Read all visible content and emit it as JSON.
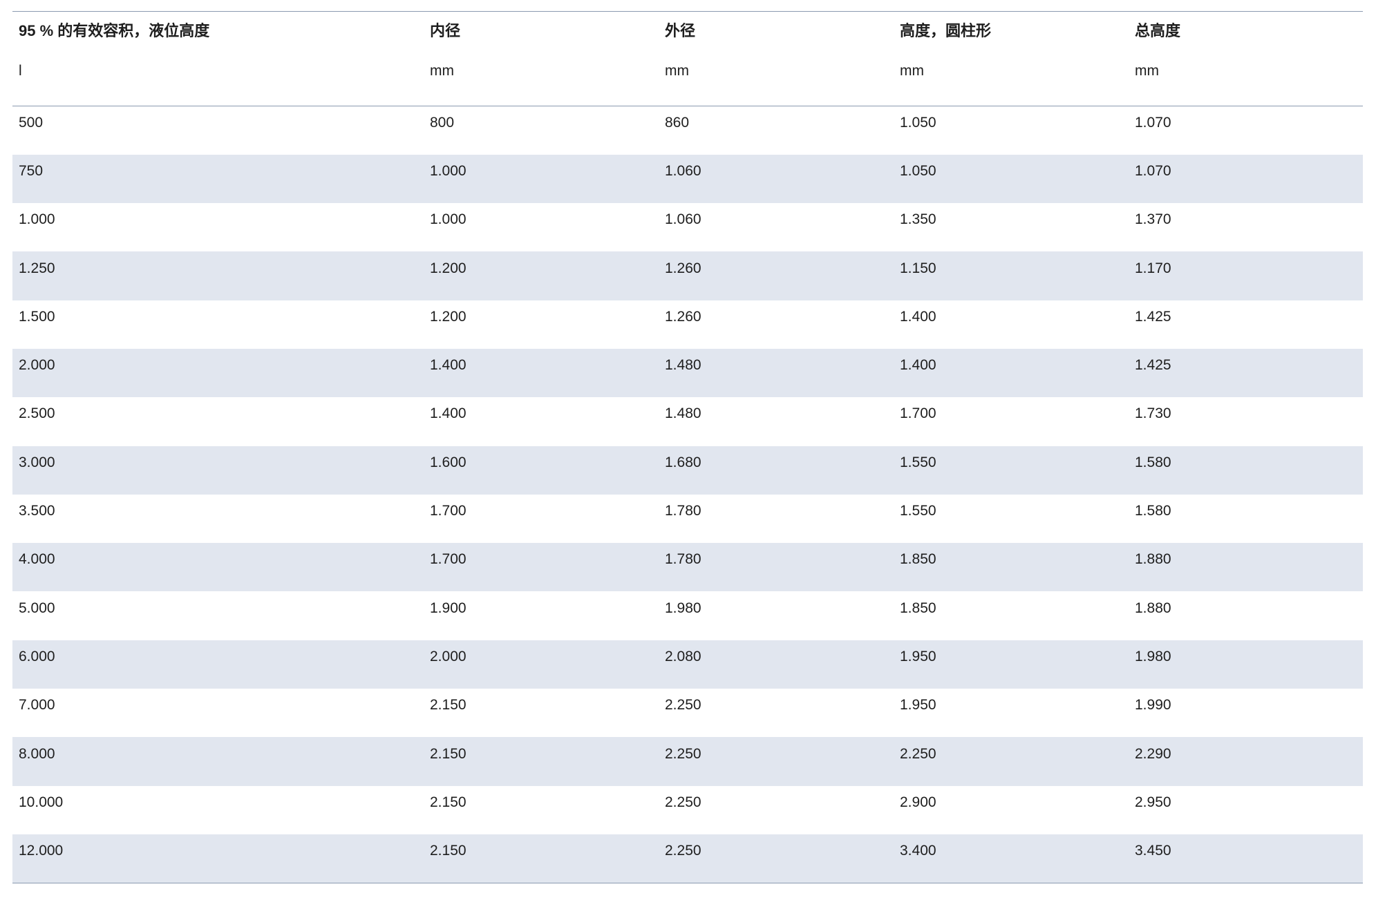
{
  "table": {
    "headers": [
      "95 % 的有效容积，液位高度",
      "内径",
      "外径",
      "高度，圆柱形",
      "总高度"
    ],
    "units": [
      "l",
      "mm",
      "mm",
      "mm",
      "mm"
    ],
    "rows": [
      [
        "500",
        "800",
        "860",
        "1.050",
        "1.070"
      ],
      [
        "750",
        "1.000",
        "1.060",
        "1.050",
        "1.070"
      ],
      [
        "1.000",
        "1.000",
        "1.060",
        "1.350",
        "1.370"
      ],
      [
        "1.250",
        "1.200",
        "1.260",
        "1.150",
        "1.170"
      ],
      [
        "1.500",
        "1.200",
        "1.260",
        "1.400",
        "1.425"
      ],
      [
        "2.000",
        "1.400",
        "1.480",
        "1.400",
        "1.425"
      ],
      [
        "2.500",
        "1.400",
        "1.480",
        "1.700",
        "1.730"
      ],
      [
        "3.000",
        "1.600",
        "1.680",
        "1.550",
        "1.580"
      ],
      [
        "3.500",
        "1.700",
        "1.780",
        "1.550",
        "1.580"
      ],
      [
        "4.000",
        "1.700",
        "1.780",
        "1.850",
        "1.880"
      ],
      [
        "5.000",
        "1.900",
        "1.980",
        "1.850",
        "1.880"
      ],
      [
        "6.000",
        "2.000",
        "2.080",
        "1.950",
        "1.980"
      ],
      [
        "7.000",
        "2.150",
        "2.250",
        "1.950",
        "1.990"
      ],
      [
        "8.000",
        "2.150",
        "2.250",
        "2.250",
        "2.290"
      ],
      [
        "10.000",
        "2.150",
        "2.250",
        "2.900",
        "2.950"
      ],
      [
        "12.000",
        "2.150",
        "2.250",
        "3.400",
        "3.450"
      ]
    ]
  },
  "colors": {
    "stripe": "#e1e6ef",
    "rule": "#8a9ab0",
    "text": "#1e1e1e"
  }
}
